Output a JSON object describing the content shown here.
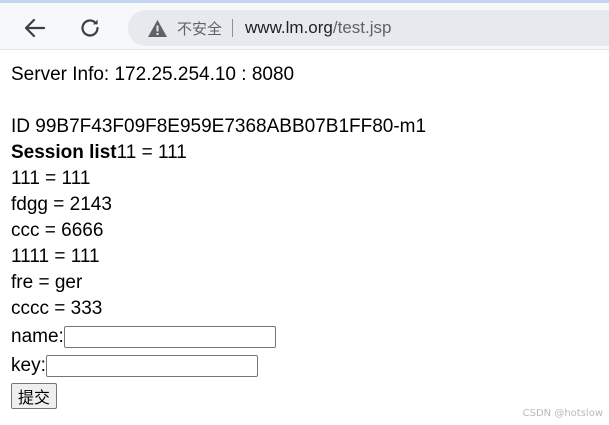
{
  "browser": {
    "security_label": "不安全",
    "url_host": "www.lm.org",
    "url_path": "/test.jsp",
    "back_icon": "arrow-left-icon",
    "reload_icon": "reload-icon",
    "security_icon": "warning-triangle-icon"
  },
  "page": {
    "server_info": "Server Info: 172.25.254.10 : 8080",
    "session_id": "ID 99B7F43F09F8E959E7368ABB07B1FF80-m1",
    "session_list_label": "Session list",
    "session_entries": [
      "11 = 111",
      "111 = 111",
      "fdgg = 2143",
      "ccc = 6666",
      "1111 = 111",
      "fre = ger",
      "cccc = 333"
    ],
    "form": {
      "name_label": "name:",
      "name_value": "",
      "key_label": "key:",
      "key_value": "",
      "submit_label": "提交"
    }
  },
  "watermark": "CSDN @hotslow"
}
